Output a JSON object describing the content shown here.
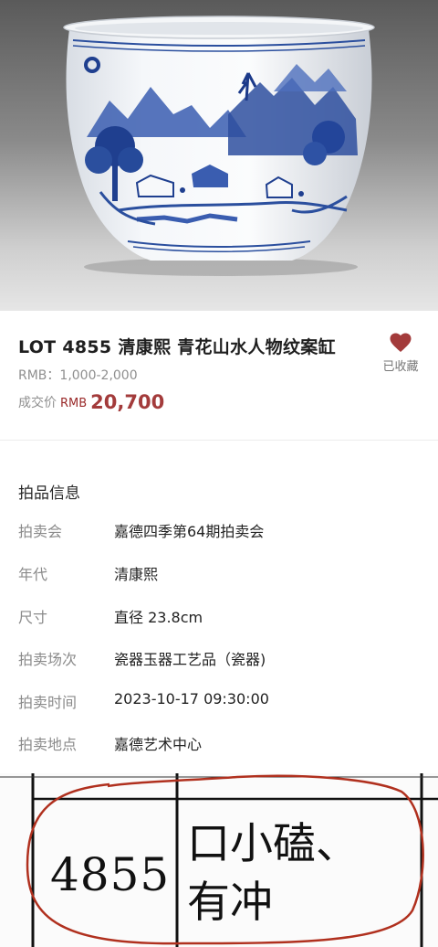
{
  "lot": {
    "title": "LOT 4855 清康熙  青花山水人物纹案缸",
    "estimate": "RMB：1,000-2,000",
    "deal_label": "成交价",
    "deal_currency": "RMB",
    "deal_price": "20,700",
    "favorite_label": "已收藏",
    "favorite_color": "#a33b3b"
  },
  "info": {
    "heading": "拍品信息",
    "rows": [
      {
        "key": "拍卖会",
        "value": "嘉德四季第64期拍卖会"
      },
      {
        "key": "年代",
        "value": "清康熙"
      },
      {
        "key": "尺寸",
        "value": "直径 23.8cm"
      },
      {
        "key": "拍卖场次",
        "value": "瓷器玉器工艺品（瓷器)"
      },
      {
        "key": "拍卖时间",
        "value": "2023-10-17 09:30:00"
      },
      {
        "key": "拍卖地点",
        "value": "嘉德艺术中心"
      }
    ]
  },
  "scan": {
    "lot_number": "4855",
    "note_line1": "口小磕、",
    "note_line2": "有冲",
    "circle_color": "#b0301e"
  },
  "icons": {
    "favorite": "heart-icon"
  }
}
